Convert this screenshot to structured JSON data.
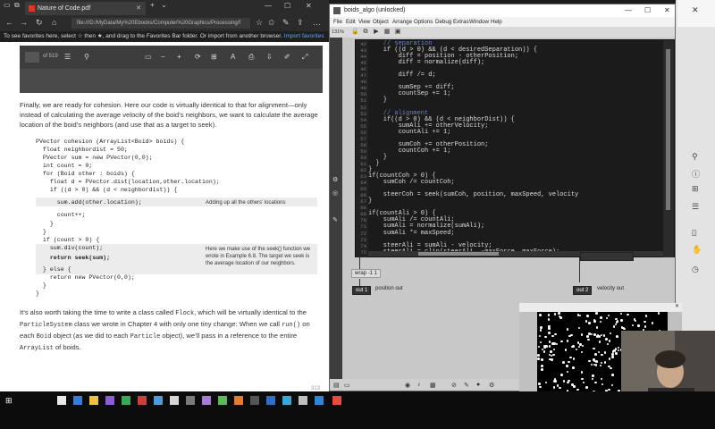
{
  "browser": {
    "tab_title": "Nature of Code.pdf",
    "tab_close": "✕",
    "address": "file:///D:/MyData/My%20Ebooks/Computer%20Graphics/Processing/f",
    "favorites_prefix": "To see favorites here, select",
    "favorites_middle": "then ★, and drag to the Favorites Bar folder. Or import from another browser.",
    "favorites_link": "Import favorites",
    "pdf_page_current": "",
    "pdf_page_total": "of 519"
  },
  "pdf": {
    "para1": "Finally, we are ready for cohesion. Here our code is virtually identical to that for alignment—only instead of calculating the average velocity of the boid’s neighbors, we want to calculate the average location of the boid’s neighbors (and use that as a target to seek).",
    "code": [
      "PVector cohesion (ArrayList<Boid> boids) {",
      "  float neighbordist = 50;",
      "  PVector sum = new PVector(0,0);",
      "  int count = 0;",
      "  for (Boid other : boids) {",
      "    float d = PVector.dist(location,other.location);",
      "    if ((d > 0) && (d < neighbordist)) {",
      "      sum.add(other.location);",
      "      count++;",
      "    }",
      "  }",
      "  if (count > 0) {",
      "    sum.div(count);",
      "    return seek(sum);",
      "  } else {",
      "    return new PVector(0,0);",
      "  }",
      "}"
    ],
    "ann1": "Adding up all the others’ locations",
    "ann2": "Here we make use of the seek() function we wrote in Example 6.8. The target we seek is the average location of our neighbors.",
    "para2_a": "It’s also worth taking the time to write a class called",
    "para2_flock": "Flock",
    "para2_b": ", which will be virtually identical to the",
    "para2_ps": "ParticleSystem",
    "para2_c": "class we wrote in Chapter 4 with only one tiny change: When we call",
    "para2_run": "run()",
    "para2_d": "on each",
    "para2_boid": "Boid",
    "para2_e": "object (as we did to each",
    "para2_particle": "Particle",
    "para2_f": "object), we’ll pass in a reference to the entire",
    "para2_al": "ArrayList",
    "para2_g": "of boids.",
    "page_number": "313"
  },
  "ide": {
    "title": "boids_algo (unlocked)",
    "menu": [
      "File",
      "Edit",
      "View",
      "Object",
      "Arrange",
      "Options",
      "Debug",
      "Extras",
      "Window",
      "Help"
    ],
    "zoom": "131%",
    "code_lines": [
      {
        "n": "42",
        "t": "    // separation"
      },
      {
        "n": "43",
        "t": "    if ((d > 0) && (d < desiredSeparation)) {"
      },
      {
        "n": "44",
        "t": "        diff = position - otherPosition;"
      },
      {
        "n": "45",
        "t": "        diff = normalize(diff);"
      },
      {
        "n": "46",
        "t": ""
      },
      {
        "n": "47",
        "t": "        diff /= d;"
      },
      {
        "n": "48",
        "t": ""
      },
      {
        "n": "49",
        "t": "        sumSep += diff;"
      },
      {
        "n": "50",
        "t": "        countSep += 1;"
      },
      {
        "n": "51",
        "t": "    }"
      },
      {
        "n": "52",
        "t": ""
      },
      {
        "n": "53",
        "t": "    // alignment"
      },
      {
        "n": "54",
        "t": "    if((d > 0) && (d < neighborDist)) {"
      },
      {
        "n": "55",
        "t": "        sumAli += otherVelocity;"
      },
      {
        "n": "56",
        "t": "        countAli += 1;"
      },
      {
        "n": "57",
        "t": ""
      },
      {
        "n": "58",
        "t": "        sumCoh += otherPosition;"
      },
      {
        "n": "59",
        "t": "        countCoh += 1;"
      },
      {
        "n": "60",
        "t": "    }"
      },
      {
        "n": "61",
        "t": "  }"
      },
      {
        "n": "62",
        "t": "}"
      },
      {
        "n": "63",
        "t": "if(countCoh > 0) {"
      },
      {
        "n": "64",
        "t": "    sumCoh /= countCoh;"
      },
      {
        "n": "65",
        "t": ""
      },
      {
        "n": "66",
        "t": "    steerCoh = seek(sumCoh, position, maxSpeed, velocity"
      },
      {
        "n": "67",
        "t": "}"
      },
      {
        "n": "68",
        "t": ""
      },
      {
        "n": "69",
        "t": "if(countAli > 0) {"
      },
      {
        "n": "70",
        "t": "    sumAli /= countAli;"
      },
      {
        "n": "71",
        "t": "    sumAli = normalize(sumAli);"
      },
      {
        "n": "72",
        "t": "    sumAli *= maxSpeed;"
      },
      {
        "n": "73",
        "t": ""
      },
      {
        "n": "74",
        "t": "    steerAli = sumAli - velocity;"
      },
      {
        "n": "75",
        "t": "    steerAli = clip(steerAli, -maxForce, maxForce);"
      }
    ],
    "wrap_node": "wrap -1 1",
    "out1": "out 1",
    "out1_label": "position out",
    "out2": "out 2",
    "out2_label": "velocity out"
  },
  "sketch": {
    "title": "",
    "close": "✕"
  },
  "icons": {
    "windows": "windows-icon"
  }
}
